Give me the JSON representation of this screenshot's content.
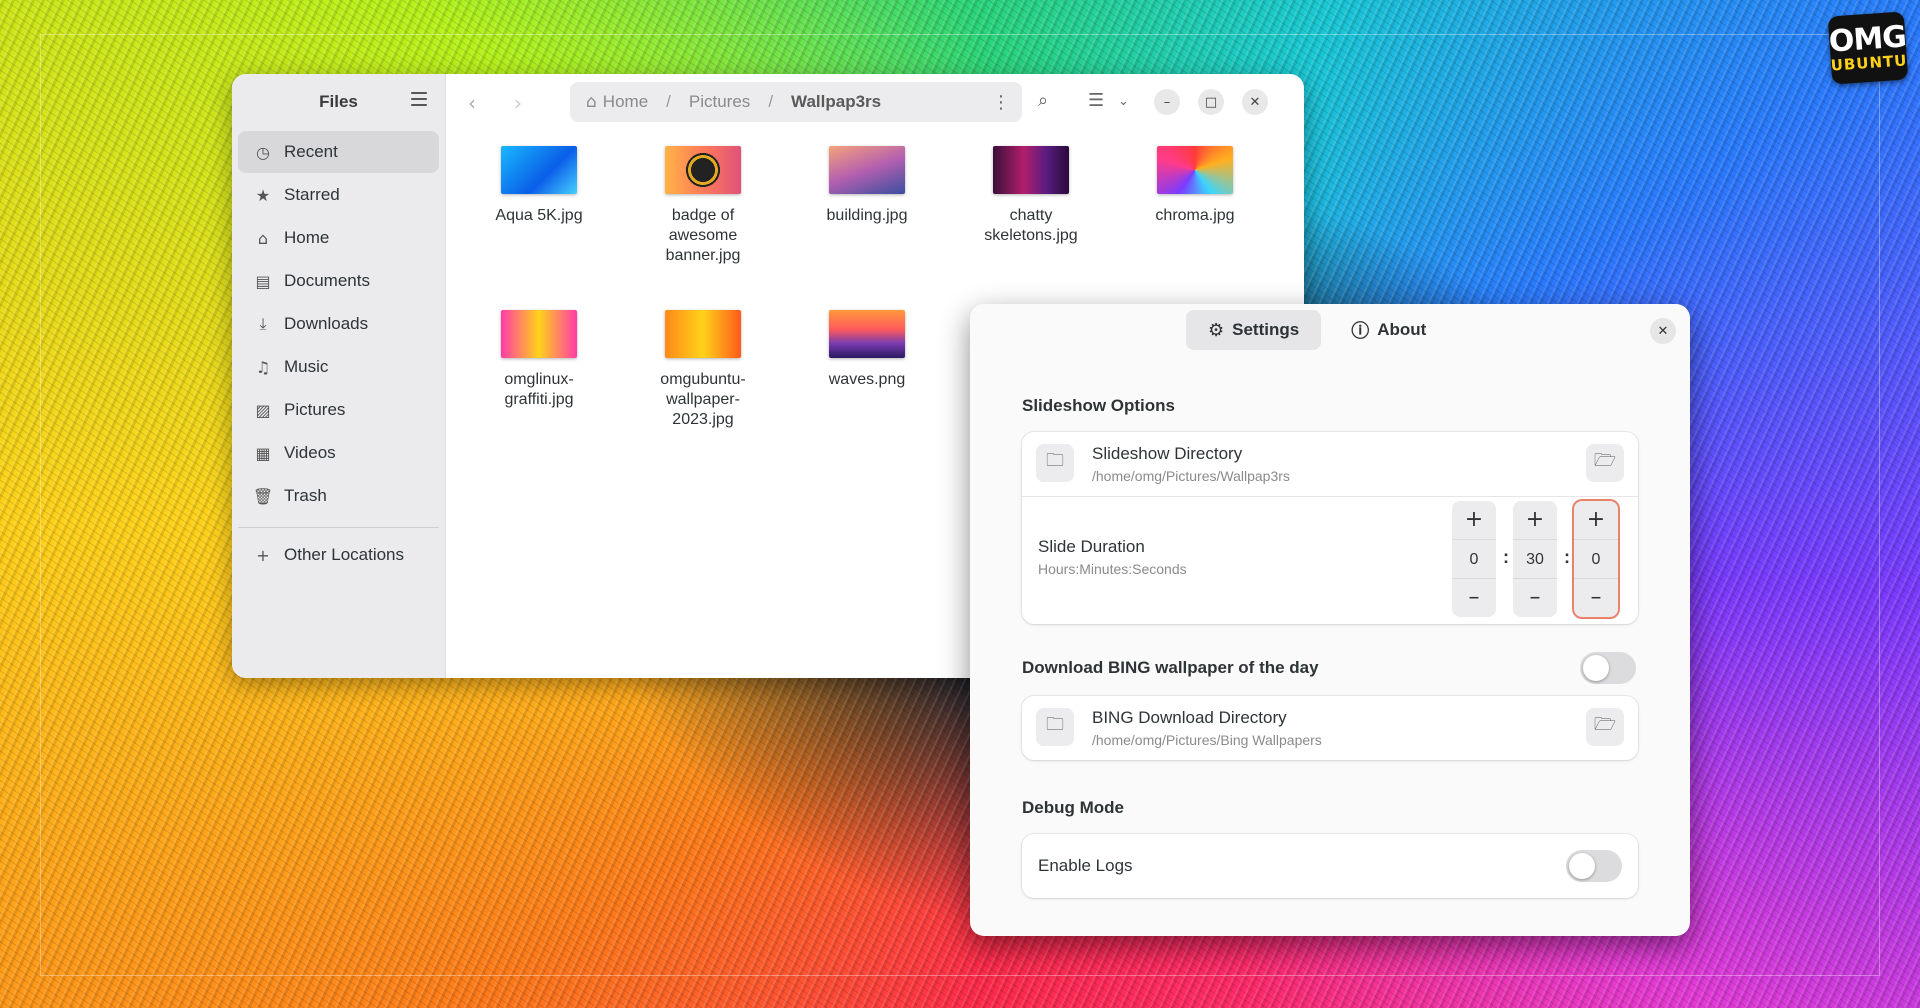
{
  "logo": {
    "line1": "OMG",
    "line2": "UBUNTU"
  },
  "files": {
    "title": "Files",
    "sidebar": [
      {
        "label": "Recent",
        "icon": "clock-icon",
        "glyph": "◷",
        "active": true
      },
      {
        "label": "Starred",
        "icon": "star-icon",
        "glyph": "★"
      },
      {
        "label": "Home",
        "icon": "home-icon",
        "glyph": "⌂"
      },
      {
        "label": "Documents",
        "icon": "document-icon",
        "glyph": "▤"
      },
      {
        "label": "Downloads",
        "icon": "download-icon",
        "glyph": "⤓"
      },
      {
        "label": "Music",
        "icon": "music-icon",
        "glyph": "♫"
      },
      {
        "label": "Pictures",
        "icon": "picture-icon",
        "glyph": "▨"
      },
      {
        "label": "Videos",
        "icon": "video-icon",
        "glyph": "▦"
      },
      {
        "label": "Trash",
        "icon": "trash-icon",
        "glyph": "🗑"
      }
    ],
    "other_locations": "Other Locations",
    "path": {
      "home": "Home",
      "seg1": "Pictures",
      "current": "Wallpap3rs"
    },
    "items": [
      {
        "name": "Aqua 5K.jpg",
        "thumb": "linear-gradient(135deg,#1ab8ff,#0a5ee8 60%,#47d0ff)"
      },
      {
        "name": "badge of awesome banner.jpg",
        "thumb": "radial-gradient(circle at 50% 50%,#222 0 12px,#e2a820 12px 15px,#222 15px 17px,rgba(0,0,0,0) 17px),linear-gradient(90deg,#ffb347,#ff7a59,#e0527a)"
      },
      {
        "name": "building.jpg",
        "thumb": "linear-gradient(160deg,#f4a27a,#b45fb0 50%,#3a4fa0)"
      },
      {
        "name": "chatty skeletons.jpg",
        "thumb": "linear-gradient(90deg,#3a0f3a,#b21e6a 40%,#5a1c80 70%,#2a0a3a)"
      },
      {
        "name": "chroma.jpg",
        "thumb": "conic-gradient(from 0deg,#ff3b3b,#ffb020,#3bd6ff,#7a3bff,#ff3b8a,#ff3b3b)"
      },
      {
        "name": "omglinux-graffiti.jpg",
        "thumb": "linear-gradient(90deg,#ff3ba8,#ffd21a 50%,#ff3ba8)"
      },
      {
        "name": "omgubuntu-wallpaper-2023.jpg",
        "thumb": "linear-gradient(90deg,#ff8a1a,#ffd21a 50%,#ff5a1a)"
      },
      {
        "name": "waves.png",
        "thumb": "linear-gradient(180deg,#ff9a3b 0%,#ff5a5a 40%,#7a3bb0 70%,#2a1a60)"
      }
    ]
  },
  "dialog": {
    "tabs": [
      {
        "label": "Settings",
        "icon": "gear-icon",
        "glyph": "⚙",
        "active": true
      },
      {
        "label": "About",
        "icon": "info-icon",
        "glyph": "ⓘ"
      }
    ],
    "slideshow": {
      "section": "Slideshow Options",
      "dir_title": "Slideshow Directory",
      "dir_path": "/home/omg/Pictures/Wallpap3rs",
      "duration_title": "Slide Duration",
      "duration_sub": "Hours:Minutes:Seconds",
      "hours": "0",
      "minutes": "30",
      "seconds": "0"
    },
    "bing": {
      "section": "Download BING wallpaper of the day",
      "enabled": false,
      "dir_title": "BING Download Directory",
      "dir_path": "/home/omg/Pictures/Bing Wallpapers"
    },
    "debug": {
      "section": "Debug Mode",
      "logs_label": "Enable Logs",
      "enabled": false
    }
  }
}
